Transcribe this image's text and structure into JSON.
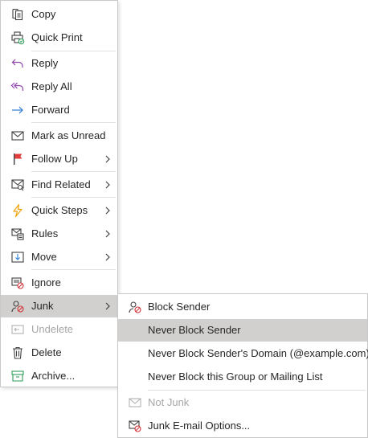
{
  "main_menu": {
    "items": [
      {
        "label": "Copy",
        "icon": "copy-icon"
      },
      {
        "label": "Quick Print",
        "icon": "quick-print-icon"
      },
      {
        "label": "Reply",
        "icon": "reply-icon"
      },
      {
        "label": "Reply All",
        "icon": "reply-all-icon"
      },
      {
        "label": "Forward",
        "icon": "forward-icon"
      },
      {
        "label": "Mark as Unread",
        "icon": "mark-unread-icon"
      },
      {
        "label": "Follow Up",
        "icon": "flag-icon"
      },
      {
        "label": "Find Related",
        "icon": "find-related-icon"
      },
      {
        "label": "Quick Steps",
        "icon": "lightning-icon"
      },
      {
        "label": "Rules",
        "icon": "rules-icon"
      },
      {
        "label": "Move",
        "icon": "move-icon"
      },
      {
        "label": "Ignore",
        "icon": "ignore-icon"
      },
      {
        "label": "Junk",
        "icon": "junk-icon"
      },
      {
        "label": "Undelete",
        "icon": "undelete-icon"
      },
      {
        "label": "Delete",
        "icon": "delete-icon"
      },
      {
        "label": "Archive...",
        "icon": "archive-icon"
      }
    ]
  },
  "junk_submenu": {
    "items": [
      {
        "label": "Block Sender",
        "icon": "block-sender-icon"
      },
      {
        "label": "Never Block Sender"
      },
      {
        "label": "Never Block Sender's Domain (@example.com)"
      },
      {
        "label": "Never Block this Group or Mailing List"
      },
      {
        "label": "Not Junk",
        "icon": "not-junk-icon"
      },
      {
        "label": "Junk E-mail Options...",
        "icon": "junk-options-icon"
      }
    ]
  },
  "colors": {
    "highlight": "#d2d0ce",
    "reply_purple": "#8e44ad",
    "forward_blue": "#2b7cd3",
    "flag_red": "#e23d3d",
    "lightning_orange": "#f0a30a",
    "archive_green": "#2e9e5b",
    "block_red": "#d13438",
    "disabled": "#a6a6a6"
  }
}
